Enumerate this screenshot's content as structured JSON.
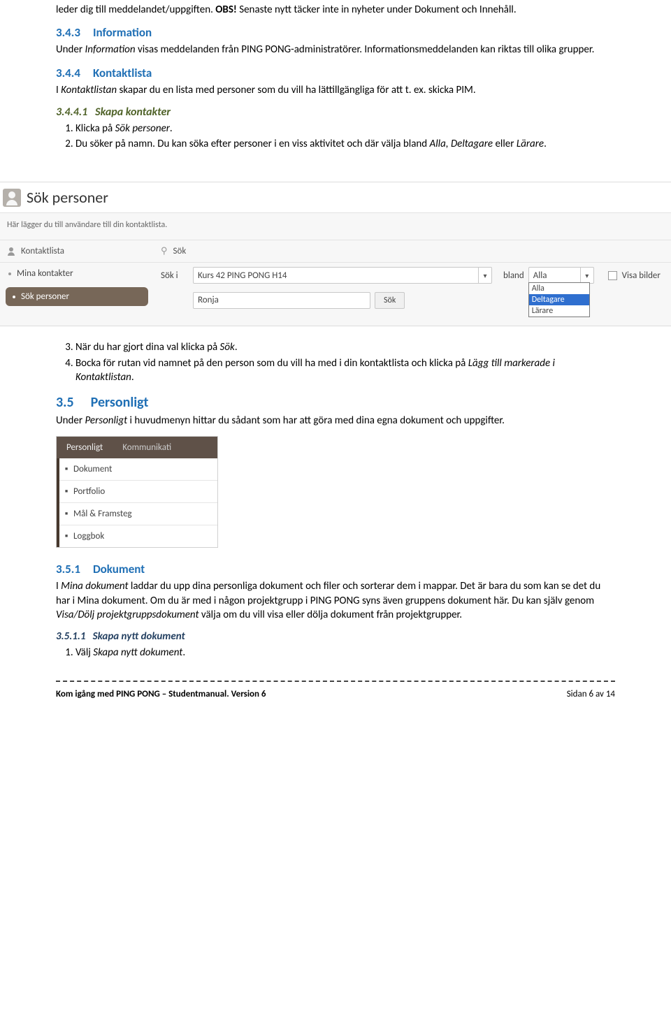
{
  "intro": {
    "line1_a": "leder dig till meddelandet/uppgiften. ",
    "line1_b": "OBS!",
    "line1_c": " Senaste nytt täcker inte in nyheter under Dokument och Innehåll."
  },
  "s343": {
    "num": "3.4.3",
    "title": "Information",
    "body_a": "Under ",
    "body_b": "Information",
    "body_c": " visas meddelanden från PING PONG-administratörer. Informationsmeddelanden kan riktas till olika grupper."
  },
  "s344": {
    "num": "3.4.4",
    "title": "Kontaktlista",
    "body_a": "I ",
    "body_b": "Kontaktlistan",
    "body_c": " skapar du en lista med personer som du vill ha lättillgängliga för att t. ex. skicka PIM."
  },
  "s3441": {
    "num": "3.4.4.1",
    "title": "Skapa kontakter",
    "li1_a": "Klicka på ",
    "li1_b": "Sök personer",
    "li1_c": ".",
    "li2_a": "Du söker på namn. Du kan söka efter personer i en viss aktivitet och där välja bland ",
    "li2_b": "Alla, Deltagare ",
    "li2_c": "eller ",
    "li2_d": "Lärare",
    "li2_e": "."
  },
  "sokui": {
    "title": "Sök personer",
    "desc": "Här lägger du till användare till din kontaktlista.",
    "left": {
      "hdr": "Kontaktlista",
      "item1": "Mina kontakter",
      "item2": "Sök personer"
    },
    "right": {
      "hdr": "Sök",
      "row1_label": "Sök i",
      "row1_value": "Kurs 42 PING PONG H14",
      "row1_bland_label": "bland",
      "row1_bland_value": "Alla",
      "row1_visa": "Visa bilder",
      "row2_input": "Ronja",
      "row2_btn": "Sök",
      "dropdown": {
        "o1": "Alla",
        "o2": "Deltagare",
        "o3": "Lärare"
      }
    }
  },
  "after_sok": {
    "li3_a": "När du har gjort dina val klicka på ",
    "li3_b": "Sök",
    "li3_c": ".",
    "li4_a": "Bocka för rutan vid namnet på den person som du vill ha med i din kontaktlista och klicka på ",
    "li4_b": "Lägg till markerade i Kontaktlistan",
    "li4_c": "."
  },
  "s35": {
    "num": "3.5",
    "title": "Personligt",
    "body_a": "Under ",
    "body_b": "Personligt",
    "body_c": " i huvudmenyn hittar du sådant som har att göra med dina egna dokument och uppgifter."
  },
  "persmenu": {
    "tab1": "Personligt",
    "tab2": "Kommunikati",
    "items": {
      "i1": "Dokument",
      "i2": "Portfolio",
      "i3": "Mål & Framsteg",
      "i4": "Loggbok"
    }
  },
  "s351": {
    "num": "3.5.1",
    "title": "Dokument",
    "body_a": "I ",
    "body_b": "Mina dokument",
    "body_c": " laddar du upp dina personliga dokument och filer och sorterar dem i mappar. Det är bara du som kan se det du har i Mina dokument. Om du är med i någon projektgrupp i PING PONG syns även gruppens dokument här. Du kan själv genom ",
    "body_d": "Visa/Dölj projektgruppsdokument",
    "body_e": " välja om du vill visa eller dölja dokument från projektgrupper."
  },
  "s3511": {
    "num": "3.5.1.1",
    "title": "Skapa nytt dokument",
    "li1_a": "Välj ",
    "li1_b": "Skapa nytt dokument",
    "li1_c": "."
  },
  "footer": {
    "left": "Kom igång med PING PONG – Studentmanual. Version 6",
    "right": "Sidan 6 av 14"
  }
}
